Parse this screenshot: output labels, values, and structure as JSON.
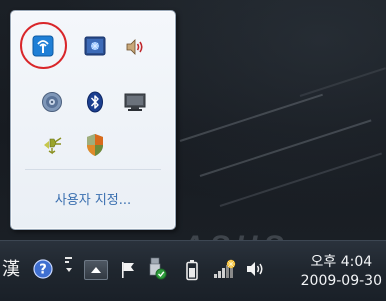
{
  "tray_popup": {
    "customize_label": "사용자 지정...",
    "icons": [
      {
        "name": "wireless-network-icon",
        "highlighted": true
      },
      {
        "name": "display-settings-icon"
      },
      {
        "name": "speaker-volume-icon"
      },
      {
        "name": "disc-drive-icon"
      },
      {
        "name": "bluetooth-icon"
      },
      {
        "name": "display-monitor-icon"
      },
      {
        "name": "power-plug-icon"
      },
      {
        "name": "security-shield-icon"
      }
    ]
  },
  "taskbar": {
    "ime_label": "漢",
    "clock": {
      "time": "오후 4:04",
      "date": "2009-09-30"
    },
    "icons": [
      "ime-pad-icon",
      "ime-options-icon",
      "show-hidden-icons-button",
      "action-center-flag-icon",
      "safely-remove-hardware-icon",
      "battery-icon",
      "network-signal-icon",
      "volume-icon"
    ]
  },
  "colors": {
    "highlight_circle": "#d9262a",
    "link": "#3a6fb0",
    "taskbar_text": "#f3f5f7"
  }
}
